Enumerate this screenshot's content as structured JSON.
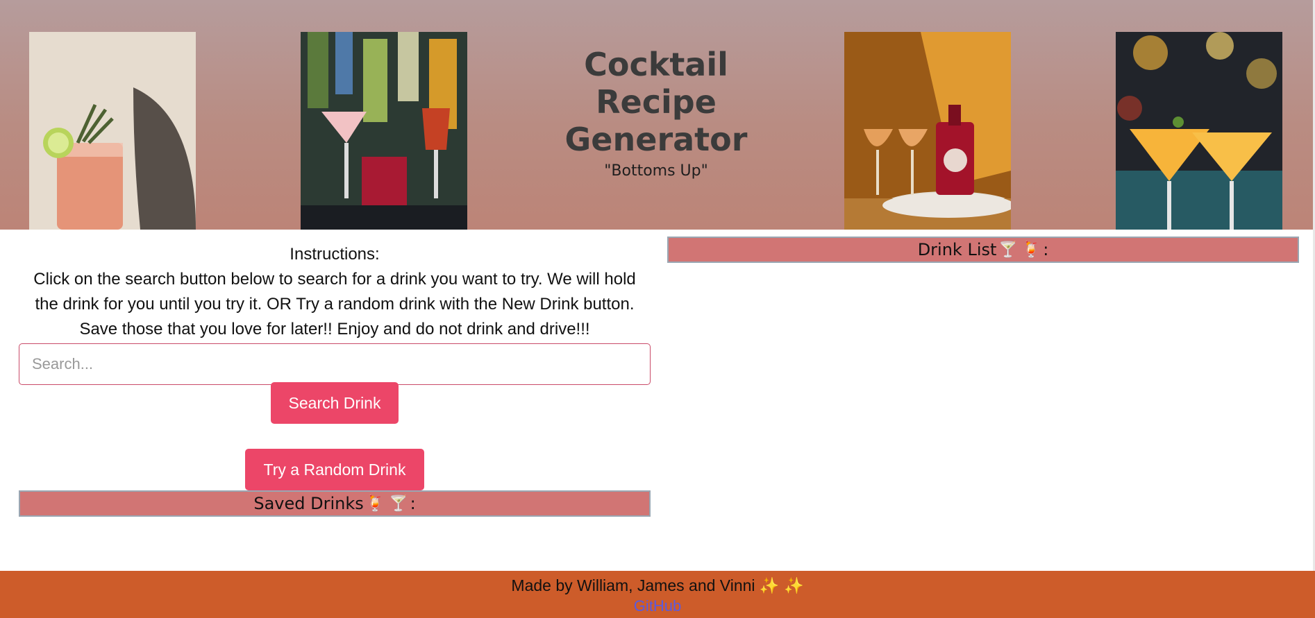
{
  "header": {
    "title_line1": "Cocktail",
    "title_line2": "Recipe",
    "title_line3": "Generator",
    "subtitle": "\"Bottoms Up\"",
    "images": [
      {
        "name": "cocktail-photo-rosemary"
      },
      {
        "name": "cocktail-photo-bar"
      },
      {
        "name": "cocktail-photo-bottle"
      },
      {
        "name": "cocktail-photo-martini"
      }
    ]
  },
  "instructions": {
    "heading": "Instructions:",
    "line1": "Click on the search button below to search for a drink you want to try. We will hold",
    "line2": "the drink for you until you try it. OR Try a random drink with the New Drink button.",
    "line3": "Save those that you love for later!! Enjoy and do not drink and drive!!!"
  },
  "search": {
    "placeholder": "Search..."
  },
  "buttons": {
    "search_label": "Search Drink",
    "random_label": "Try a Random Drink"
  },
  "saved_drinks": {
    "label": "Saved Drinks",
    "suffix": ":"
  },
  "drink_list": {
    "label": "Drink List",
    "suffix": ":"
  },
  "footer": {
    "text": "Made by William, James and Vinni",
    "link_label": "GitHub"
  },
  "colors": {
    "button": "#ec4668",
    "bar": "#d17574",
    "footer": "#cd5c2a",
    "link": "#5a5ae0"
  },
  "icons": [
    "cocktail-icon",
    "tropical-drink-icon",
    "sparkles-icon"
  ]
}
